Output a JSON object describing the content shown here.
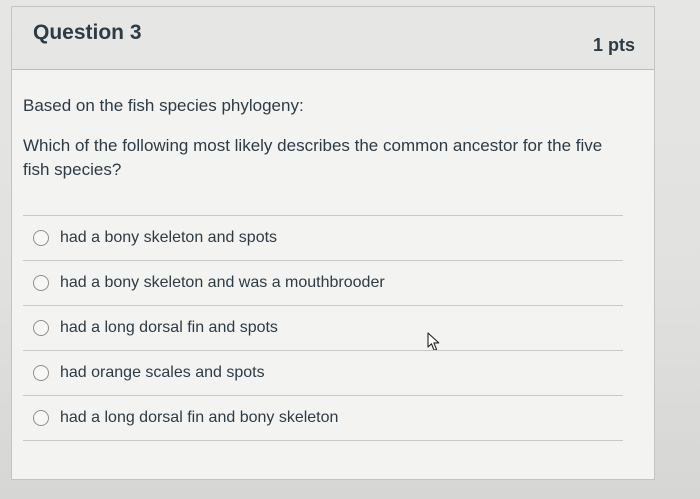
{
  "question": {
    "title": "Question 3",
    "points": "1 pts",
    "prompt": "Based on the fish species phylogeny:",
    "text": "Which of the following most likely describes the common ancestor for the five fish species?"
  },
  "answers": [
    {
      "label": "had a bony skeleton and spots",
      "selected": false
    },
    {
      "label": "had a bony skeleton and was a mouthbrooder",
      "selected": false
    },
    {
      "label": "had a long dorsal fin and spots",
      "selected": false
    },
    {
      "label": "had orange scales and spots",
      "selected": false
    },
    {
      "label": "had a long dorsal fin and bony skeleton",
      "selected": false
    }
  ],
  "colors": {
    "text": "#2d3b45",
    "header_bg": "#e6e6e5",
    "card_bg": "#f3f3f2",
    "border": "#c4c4c2"
  },
  "icons": {
    "cursor": "mouse-pointer-icon",
    "radio": "radio-button-icon"
  }
}
